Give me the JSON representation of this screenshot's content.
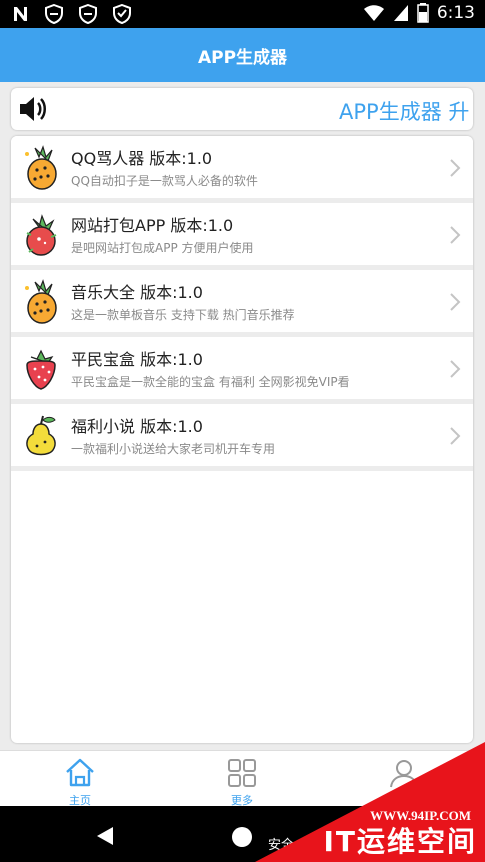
{
  "status_bar": {
    "time": "6:13",
    "icons": [
      "n-icon",
      "alert-shield-icon",
      "alert-shield-icon",
      "shield-check-icon",
      "wifi-icon",
      "signal-icon",
      "battery-icon"
    ]
  },
  "app_bar": {
    "title": "APP生成器"
  },
  "notice": {
    "icon": "speaker-icon",
    "text": "APP生成器 升"
  },
  "apps": [
    {
      "title": "QQ骂人器 版本:1.0",
      "desc": "QQ自动扣子是一款骂人必备的软件",
      "icon": "pineapple-icon"
    },
    {
      "title": "网站打包APP 版本:1.0",
      "desc": "是吧网站打包成APP 方便用户使用",
      "icon": "dragonfruit-icon"
    },
    {
      "title": "音乐大全 版本:1.0",
      "desc": "这是一款单板音乐 支持下载 热门音乐推荐",
      "icon": "pineapple-icon"
    },
    {
      "title": "平民宝盒 版本:1.0",
      "desc": "平民宝盒是一款全能的宝盒 有福利 全网影视免VIP看",
      "icon": "strawberry-icon"
    },
    {
      "title": "福利小说 版本:1.0",
      "desc": "一款福利小说送给大家老司机开车专用",
      "icon": "pear-icon"
    }
  ],
  "tabs": [
    {
      "label": "主页",
      "icon": "home-icon",
      "active": true
    },
    {
      "label": "更多",
      "icon": "grid-icon",
      "active": false
    },
    {
      "label": "",
      "icon": "user-icon",
      "active": false
    }
  ],
  "nav_bar": {
    "text": "安全"
  },
  "watermark": {
    "url": "WWW.94IP.COM",
    "brand": "IT运维空间"
  },
  "colors": {
    "accent": "#3ea2ee",
    "background": "#ececec",
    "watermark": "#e8141b"
  }
}
